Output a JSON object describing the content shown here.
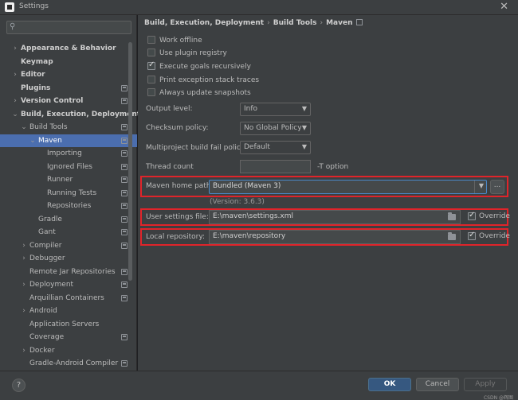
{
  "window": {
    "title": "Settings",
    "close_glyph": "✕"
  },
  "search": {
    "icon": "search-icon",
    "value": ""
  },
  "sidebar": {
    "items": [
      {
        "label": "Appearance & Behavior",
        "bold": true,
        "arrow": "›"
      },
      {
        "label": "Keymap",
        "bold": true,
        "arrow": ""
      },
      {
        "label": "Editor",
        "bold": true,
        "arrow": "›"
      },
      {
        "label": "Plugins",
        "bold": true,
        "arrow": "",
        "project_icon": true
      },
      {
        "label": "Version Control",
        "bold": true,
        "arrow": "›",
        "project_icon": true
      },
      {
        "label": "Build, Execution, Deployment",
        "bold": true,
        "arrow": "⌄"
      },
      {
        "label": "Build Tools",
        "arrow": "⌄",
        "project_icon": true
      },
      {
        "label": "Maven",
        "arrow": "⌄",
        "project_icon": true,
        "selected": true
      },
      {
        "label": "Importing",
        "project_icon": true
      },
      {
        "label": "Ignored Files",
        "project_icon": true
      },
      {
        "label": "Runner",
        "project_icon": true
      },
      {
        "label": "Running Tests",
        "project_icon": true
      },
      {
        "label": "Repositories",
        "project_icon": true
      },
      {
        "label": "Gradle",
        "project_icon": true
      },
      {
        "label": "Gant",
        "project_icon": true
      },
      {
        "label": "Compiler",
        "arrow": "›",
        "project_icon": true
      },
      {
        "label": "Debugger",
        "arrow": "›"
      },
      {
        "label": "Remote Jar Repositories",
        "project_icon": true
      },
      {
        "label": "Deployment",
        "arrow": "›",
        "project_icon": true
      },
      {
        "label": "Arquillian Containers",
        "project_icon": true
      },
      {
        "label": "Android",
        "arrow": "›"
      },
      {
        "label": "Application Servers"
      },
      {
        "label": "Coverage",
        "project_icon": true
      },
      {
        "label": "Docker",
        "arrow": "›"
      },
      {
        "label": "Gradle-Android Compiler",
        "project_icon": true
      }
    ]
  },
  "breadcrumb": {
    "items": [
      "Build, Execution, Deployment",
      "Build Tools",
      "Maven"
    ],
    "separator": "›"
  },
  "options": {
    "work_offline": {
      "label": "Work offline",
      "checked": false
    },
    "use_plugin_registry": {
      "label": "Use plugin registry",
      "checked": false
    },
    "execute_goals_recursively": {
      "label": "Execute goals recursively",
      "checked": true
    },
    "print_exception_stack_traces": {
      "label": "Print exception stack traces",
      "checked": false
    },
    "always_update_snapshots": {
      "label": "Always update snapshots",
      "checked": false
    }
  },
  "form": {
    "output_level": {
      "label": "Output level:",
      "value": "Info"
    },
    "checksum_policy": {
      "label": "Checksum policy:",
      "value": "No Global Policy"
    },
    "multiproject_build_fail_policy": {
      "label": "Multiproject build fail policy:",
      "value": "Default"
    },
    "thread_count": {
      "label": "Thread count",
      "value": "",
      "hint": "-T option"
    },
    "maven_home_path": {
      "label": "Maven home path:",
      "value": "Bundled (Maven 3)",
      "version": "(Version: 3.6.3)",
      "browse": "..."
    },
    "user_settings_file": {
      "label": "User settings file:",
      "value": "E:\\maven\\settings.xml",
      "override_label": "Override",
      "override_checked": true
    },
    "local_repository": {
      "label": "Local repository:",
      "value": "E:\\maven\\repository",
      "override_label": "Override",
      "override_checked": true
    }
  },
  "footer": {
    "help": "?",
    "ok": "OK",
    "cancel": "Cancel",
    "apply": "Apply",
    "watermark": "CSDN @辉图"
  },
  "colors": {
    "highlight_box": "#e0242a",
    "selection": "#4b6eaf",
    "ok_button": "#365880"
  }
}
